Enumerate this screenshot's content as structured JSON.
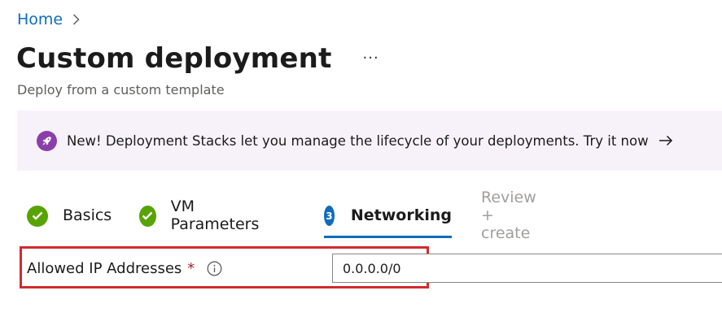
{
  "breadcrumb": {
    "home": "Home"
  },
  "header": {
    "title": "Custom deployment",
    "more": "···",
    "subtitle": "Deploy from a custom template"
  },
  "banner": {
    "text": "New! Deployment Stacks let you manage the lifecycle of your deployments. Try it now",
    "icon": "rocket-icon",
    "accent": "#8a3fa8"
  },
  "tabs": [
    {
      "label": "Basics",
      "state": "completed"
    },
    {
      "label": "VM Parameters",
      "state": "completed"
    },
    {
      "label": "Networking",
      "number": "3",
      "state": "active"
    },
    {
      "label": "Review + create",
      "state": "disabled"
    }
  ],
  "form": {
    "allowed_ip": {
      "label": "Allowed IP Addresses",
      "required_marker": "*",
      "value": "0.0.0.0/0"
    }
  },
  "colors": {
    "link": "#0f6cbd",
    "success": "#57a300",
    "highlight_border": "#d02b2f",
    "banner_bg": "#f7f2fa"
  }
}
